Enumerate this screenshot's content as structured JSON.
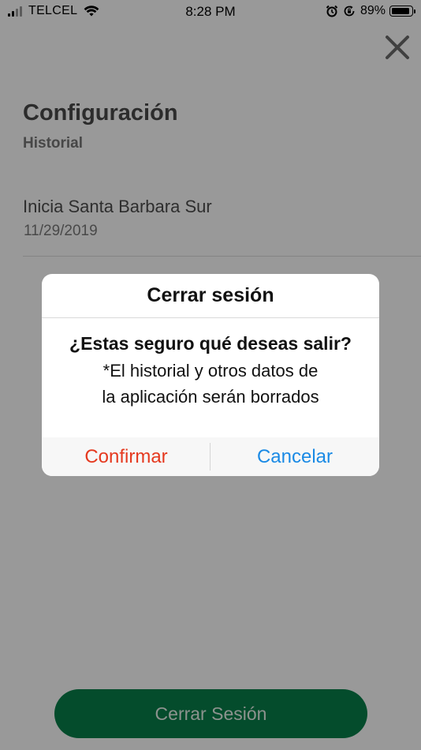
{
  "status_bar": {
    "carrier": "TELCEL",
    "time": "8:28 PM",
    "battery_percent": "89%",
    "battery_level": 0.89,
    "signal_bars_active": 2,
    "icons": [
      "signal-icon",
      "wifi-icon",
      "alarm-icon",
      "rotation-lock-icon",
      "battery-icon"
    ]
  },
  "header": {
    "close_icon": "close-icon",
    "title": "Configuración",
    "subtitle": "Historial"
  },
  "history": {
    "items": [
      {
        "name": "Inicia Santa Barbara Sur",
        "date": "11/29/2019"
      }
    ]
  },
  "bottom_button": {
    "label": "Cerrar Sesión"
  },
  "dialog": {
    "title": "Cerrar sesión",
    "question": "¿Estas seguro qué deseas salir?",
    "message_line1": "*El historial y otros datos de",
    "message_line2": "la aplicación serán borrados",
    "confirm_label": "Confirmar",
    "cancel_label": "Cancelar"
  },
  "colors": {
    "confirm": "#e5391f",
    "cancel": "#1a8ae5",
    "primary_button": "#087f4a",
    "overlay": "rgba(0,0,0,0.40)"
  }
}
